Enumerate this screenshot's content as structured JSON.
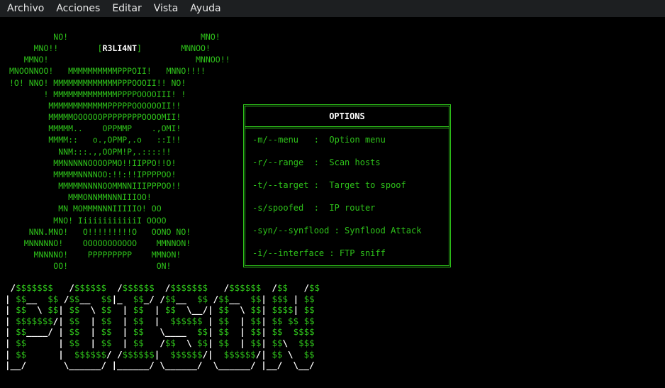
{
  "menubar": {
    "items": [
      "Archivo",
      "Acciones",
      "Editar",
      "Vista",
      "Ayuda"
    ]
  },
  "art": {
    "lines_before_name": [
      "         NO!                           MNO!",
      "     MNO!!"
    ],
    "name_prefix": "        [",
    "name": "R3LI4NT",
    "name_suffix": "]        MNNOO!",
    "lines_after_name": [
      "   MMNO!                              MNNOO!!",
      "MNOONNOO!   MMMMMMMMMMPPPOII!   MNNO!!!!",
      "!O! NNO! MMMMMMMMMMMMMPPPOOOII!! NO!",
      "       ! MMMMMMMMMMMMMPPPPOOOOIII! !",
      "        MMMMMMMMMMMMPPPPPOOOOOOII!!",
      "        MMMMMOOOOOOPPPPPPPPOOOOMII!",
      "        MMMMM..    OPPMMP    .,OMI!",
      "        MMMM::   o.,OPMP,.o   ::I!!",
      "          NNM:::.,,OOPM!P,.::::!!",
      "         MMNNNNNOOOOPMO!!IIPPO!!O!",
      "         MMMMMNNNNOO:!!:!!IPPPPOO!",
      "          MMMMMNNNNOOMMNNIIIPPPOO!!",
      "            MMMONNMMNNNIIIOO!",
      "          MN MOMMMNNNIIIIIO! OO",
      "         MNO! IiiiiiiiiiiiI OOOO",
      "    NNN.MNO!   O!!!!!!!!!O   OONO NO!",
      "   MNNNNNO!    OOOOOOOOOOO    MMNNON!",
      "     MNNNNO!    PPPPPPPPP    MMNON!",
      "         OO!                  ON!"
    ]
  },
  "options_panel": {
    "title": "OPTIONS",
    "rows": [
      "-m/--menu   :  Option menu",
      "-r/--range  :  Scan hosts",
      "-t/--target :  Target to spoof",
      "-s/spoofed  :  IP router",
      "-syn/--synflood : Synflood Attack",
      "-i/--interface : FTP sniff"
    ]
  },
  "logo": {
    "lines": [
      " /$$$$$$$   /$$$$$$  /$$$$$$  /$$$$$$$   /$$$$$$  /$$   /$$",
      "| $$__  $$ /$$__  $$|_  $$_/ /$$__  $$ /$$__  $$| $$$ | $$",
      "| $$  \\ $$| $$  \\ $$  | $$  | $$  \\__/| $$  \\ $$| $$$$| $$",
      "| $$$$$$$/| $$  | $$  | $$  |  $$$$$$ | $$  | $$| $$ $$ $$",
      "| $$____/ | $$  | $$  | $$   \\____  $$| $$  | $$| $$  $$$$",
      "| $$      | $$  | $$  | $$   /$$  \\ $$| $$  | $$| $$\\  $$$",
      "| $$      |  $$$$$$/ /$$$$$$|  $$$$$$/|  $$$$$$/| $$ \\  $$",
      "|__/       \\______/ |______/ \\______/  \\______/ |__/  \\__/"
    ]
  },
  "colors": {
    "terminal_green": "#2ec21a",
    "terminal_bg": "#000000",
    "menubar_bg": "#1d1f21"
  }
}
